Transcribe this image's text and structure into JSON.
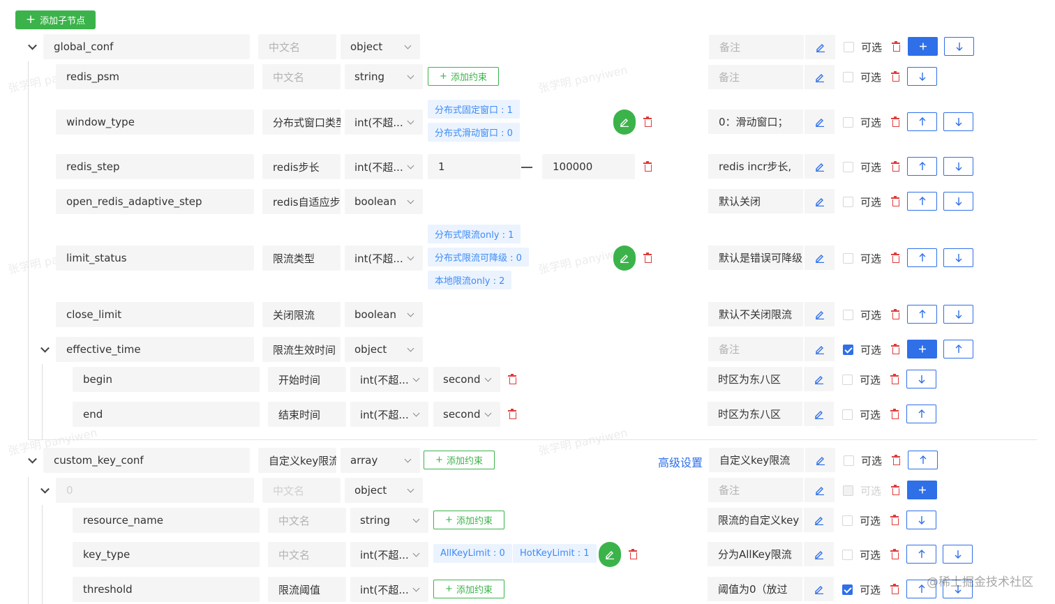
{
  "toolbar": {
    "add_child_label": "添加子节点"
  },
  "common": {
    "optional_label": "可选",
    "add_constraint_label": "添加约束",
    "dash": "—"
  },
  "rows": {
    "global_conf": {
      "name": "global_conf",
      "cn": "中文名",
      "type": "object",
      "note": "备注",
      "optional": false
    },
    "redis_psm": {
      "name": "redis_psm",
      "cn": "中文名",
      "type": "string",
      "note": "备注",
      "optional": false
    },
    "window_type": {
      "name": "window_type",
      "cn": "分布式窗口类型",
      "type": "int(不超...",
      "tags": [
        "分布式固定窗口 : 1",
        "分布式滑动窗口 : 0"
      ],
      "note": "0：滑动窗口；",
      "optional": false
    },
    "redis_step": {
      "name": "redis_step",
      "cn": "redis步长",
      "type": "int(不超...",
      "min": "1",
      "max": "100000",
      "note": "redis incr步长,",
      "optional": false
    },
    "open_redis_adaptive_step": {
      "name": "open_redis_adaptive_step",
      "cn": "redis自适应步长",
      "type": "boolean",
      "note": "默认关闭",
      "optional": false
    },
    "limit_status": {
      "name": "limit_status",
      "cn": "限流类型",
      "type": "int(不超...",
      "tags": [
        "分布式限流only : 1",
        "分布式限流可降级 : 0",
        "本地限流only : 2"
      ],
      "note": "默认是错误可降级",
      "optional": false
    },
    "close_limit": {
      "name": "close_limit",
      "cn": "关闭限流",
      "type": "boolean",
      "note": "默认不关闭限流",
      "optional": false
    },
    "effective_time": {
      "name": "effective_time",
      "cn": "限流生效时间",
      "type": "object",
      "note": "备注",
      "optional": true
    },
    "begin": {
      "name": "begin",
      "cn": "开始时间",
      "type": "int(不超...",
      "unit": "second",
      "note": "时区为东八区",
      "optional": false
    },
    "end": {
      "name": "end",
      "cn": "结束时间",
      "type": "int(不超...",
      "unit": "second",
      "note": "时区为东八区",
      "optional": false
    },
    "custom_key_conf": {
      "name": "custom_key_conf",
      "cn": "自定义key限流",
      "type": "array",
      "advanced_label": "高级设置",
      "note": "自定义key限流",
      "optional": false
    },
    "item_0": {
      "name": "0",
      "cn": "中文名",
      "type": "object",
      "note": "备注",
      "optional": false
    },
    "resource_name": {
      "name": "resource_name",
      "cn": "中文名",
      "type": "string",
      "note": "限流的自定义key",
      "optional": false
    },
    "key_type": {
      "name": "key_type",
      "cn": "中文名",
      "type": "int(不超...",
      "tags": [
        "AllKeyLimit : 0",
        "HotKeyLimit : 1"
      ],
      "note": "分为AllKey限流",
      "optional": false
    },
    "threshold": {
      "name": "threshold",
      "cn": "限流阈值",
      "type": "int(不超...",
      "note": "阈值为0（放过",
      "optional": true
    }
  },
  "watermark": {
    "corner": "@稀土掘金技术社区",
    "text": "张学明 panyiwen"
  },
  "colors": {
    "green": "#3bb34a",
    "blue": "#2f6fe8",
    "red": "#e03a3a",
    "tag_bg": "#ebf3ff",
    "input_bg": "#f5f5f5"
  }
}
